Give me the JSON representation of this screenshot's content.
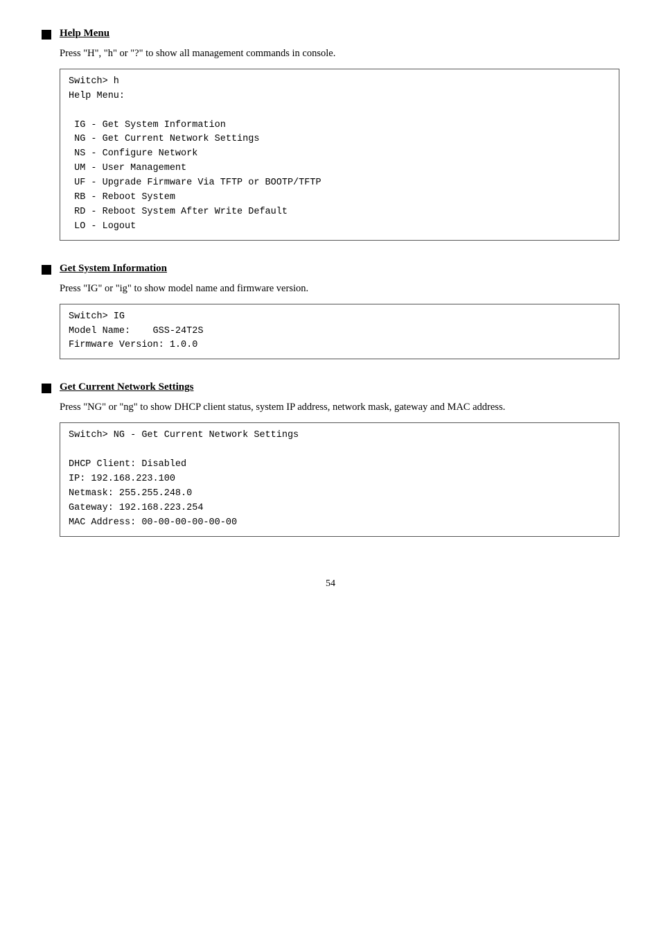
{
  "sections": [
    {
      "id": "help-menu",
      "title": "Help Menu",
      "description": "Press \"H\", \"h\" or \"?\" to show all management commands in console.",
      "code": "Switch> h\nHelp Menu:\n\n IG - Get System Information\n NG - Get Current Network Settings\n NS - Configure Network\n UM - User Management\n UF - Upgrade Firmware Via TFTP or BOOTP/TFTP\n RB - Reboot System\n RD - Reboot System After Write Default\n LO - Logout"
    },
    {
      "id": "get-system-info",
      "title": "Get System Information",
      "description": "Press \"IG\" or \"ig\" to show model name and firmware version.",
      "code": "Switch> IG\nModel Name:    GSS-24T2S\nFirmware Version: 1.0.0"
    },
    {
      "id": "get-current-network",
      "title": "Get Current Network Settings",
      "description": "Press \"NG\" or \"ng\" to show DHCP client status, system IP address, network mask, gateway and MAC address.",
      "code": "Switch> NG - Get Current Network Settings\n\nDHCP Client: Disabled\nIP: 192.168.223.100\nNetmask: 255.255.248.0\nGateway: 192.168.223.254\nMAC Address: 00-00-00-00-00-00"
    }
  ],
  "page_number": "54"
}
